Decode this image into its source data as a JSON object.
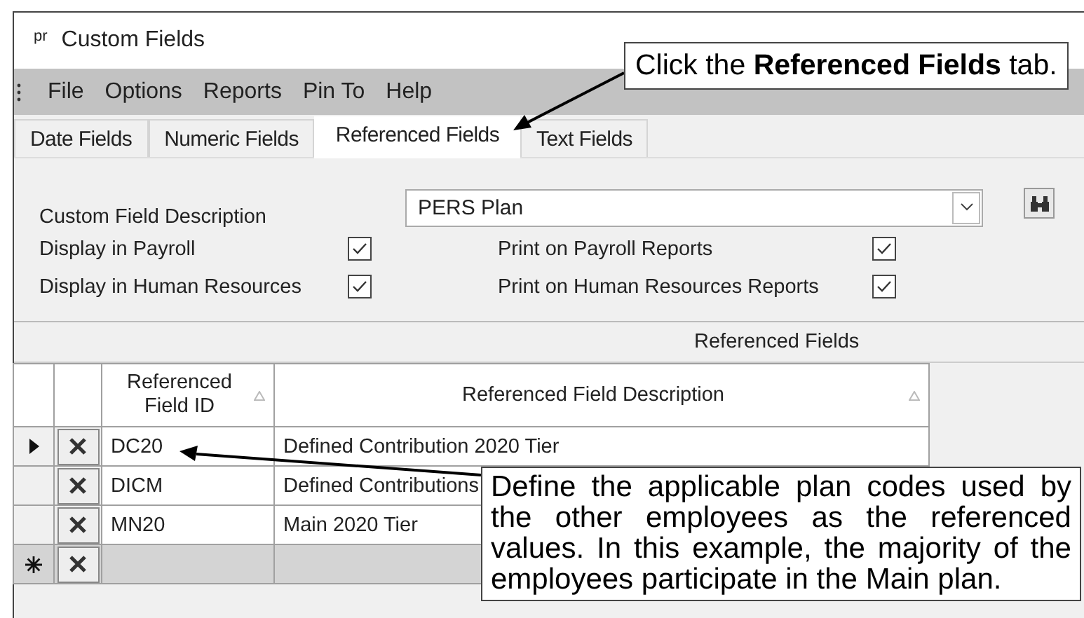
{
  "window": {
    "app_mark": "pr",
    "title": "Custom Fields"
  },
  "menu": [
    "File",
    "Options",
    "Reports",
    "Pin To",
    "Help"
  ],
  "tabs": [
    {
      "label": "Date Fields",
      "selected": false
    },
    {
      "label": "Numeric Fields",
      "selected": false
    },
    {
      "label": "Referenced Fields",
      "selected": true
    },
    {
      "label": "Text Fields",
      "selected": false
    }
  ],
  "form": {
    "description_label": "Custom Field Description",
    "description_value": "PERS Plan",
    "checks": [
      {
        "label": "Display in Payroll",
        "checked": true
      },
      {
        "label": "Print on Payroll Reports",
        "checked": true
      },
      {
        "label": "Display in Human Resources",
        "checked": true
      },
      {
        "label": "Print on Human Resources Reports",
        "checked": true
      }
    ]
  },
  "grid": {
    "title": "Referenced Fields",
    "columns": [
      "Referenced Field ID",
      "Referenced Field Description"
    ],
    "rows": [
      {
        "kind": "current",
        "id": "DC20",
        "description": "Defined Contribution 2020 Tier"
      },
      {
        "kind": "normal",
        "id": "DICM",
        "description": "Defined Contributions"
      },
      {
        "kind": "normal",
        "id": "MN20",
        "description": "Main 2020 Tier"
      },
      {
        "kind": "new"
      }
    ]
  },
  "callouts": [
    {
      "text": "Click the **Referenced Fields** tab."
    },
    {
      "text": "Define the applicable plan codes used by the other employees as the referenced values. In this example, the majority of the employees participate in the Main plan."
    }
  ]
}
